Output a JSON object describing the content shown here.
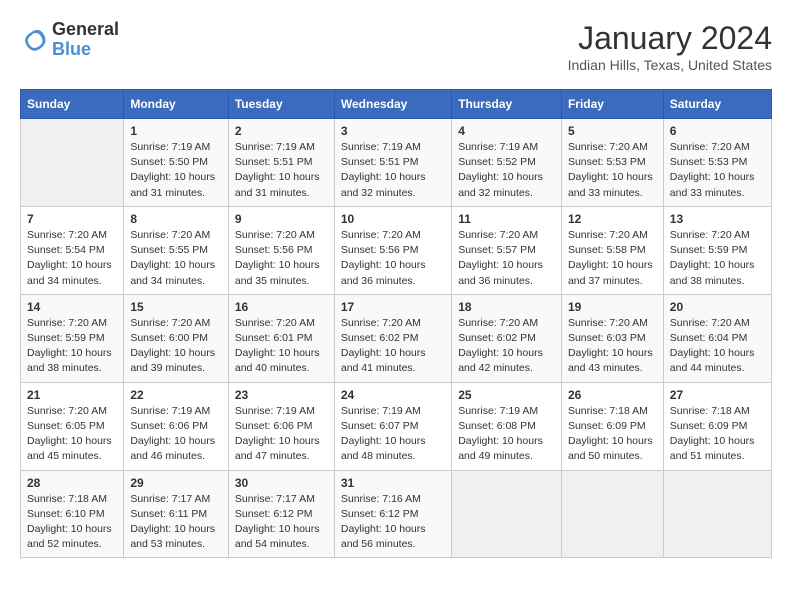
{
  "header": {
    "logo_line1": "General",
    "logo_line2": "Blue",
    "title": "January 2024",
    "subtitle": "Indian Hills, Texas, United States"
  },
  "days_of_week": [
    "Sunday",
    "Monday",
    "Tuesday",
    "Wednesday",
    "Thursday",
    "Friday",
    "Saturday"
  ],
  "weeks": [
    [
      {
        "num": "",
        "empty": true
      },
      {
        "num": "1",
        "sunrise": "7:19 AM",
        "sunset": "5:50 PM",
        "daylight": "10 hours and 31 minutes."
      },
      {
        "num": "2",
        "sunrise": "7:19 AM",
        "sunset": "5:51 PM",
        "daylight": "10 hours and 31 minutes."
      },
      {
        "num": "3",
        "sunrise": "7:19 AM",
        "sunset": "5:51 PM",
        "daylight": "10 hours and 32 minutes."
      },
      {
        "num": "4",
        "sunrise": "7:19 AM",
        "sunset": "5:52 PM",
        "daylight": "10 hours and 32 minutes."
      },
      {
        "num": "5",
        "sunrise": "7:20 AM",
        "sunset": "5:53 PM",
        "daylight": "10 hours and 33 minutes."
      },
      {
        "num": "6",
        "sunrise": "7:20 AM",
        "sunset": "5:53 PM",
        "daylight": "10 hours and 33 minutes."
      }
    ],
    [
      {
        "num": "7",
        "sunrise": "7:20 AM",
        "sunset": "5:54 PM",
        "daylight": "10 hours and 34 minutes."
      },
      {
        "num": "8",
        "sunrise": "7:20 AM",
        "sunset": "5:55 PM",
        "daylight": "10 hours and 34 minutes."
      },
      {
        "num": "9",
        "sunrise": "7:20 AM",
        "sunset": "5:56 PM",
        "daylight": "10 hours and 35 minutes."
      },
      {
        "num": "10",
        "sunrise": "7:20 AM",
        "sunset": "5:56 PM",
        "daylight": "10 hours and 36 minutes."
      },
      {
        "num": "11",
        "sunrise": "7:20 AM",
        "sunset": "5:57 PM",
        "daylight": "10 hours and 36 minutes."
      },
      {
        "num": "12",
        "sunrise": "7:20 AM",
        "sunset": "5:58 PM",
        "daylight": "10 hours and 37 minutes."
      },
      {
        "num": "13",
        "sunrise": "7:20 AM",
        "sunset": "5:59 PM",
        "daylight": "10 hours and 38 minutes."
      }
    ],
    [
      {
        "num": "14",
        "sunrise": "7:20 AM",
        "sunset": "5:59 PM",
        "daylight": "10 hours and 38 minutes."
      },
      {
        "num": "15",
        "sunrise": "7:20 AM",
        "sunset": "6:00 PM",
        "daylight": "10 hours and 39 minutes."
      },
      {
        "num": "16",
        "sunrise": "7:20 AM",
        "sunset": "6:01 PM",
        "daylight": "10 hours and 40 minutes."
      },
      {
        "num": "17",
        "sunrise": "7:20 AM",
        "sunset": "6:02 PM",
        "daylight": "10 hours and 41 minutes."
      },
      {
        "num": "18",
        "sunrise": "7:20 AM",
        "sunset": "6:02 PM",
        "daylight": "10 hours and 42 minutes."
      },
      {
        "num": "19",
        "sunrise": "7:20 AM",
        "sunset": "6:03 PM",
        "daylight": "10 hours and 43 minutes."
      },
      {
        "num": "20",
        "sunrise": "7:20 AM",
        "sunset": "6:04 PM",
        "daylight": "10 hours and 44 minutes."
      }
    ],
    [
      {
        "num": "21",
        "sunrise": "7:20 AM",
        "sunset": "6:05 PM",
        "daylight": "10 hours and 45 minutes."
      },
      {
        "num": "22",
        "sunrise": "7:19 AM",
        "sunset": "6:06 PM",
        "daylight": "10 hours and 46 minutes."
      },
      {
        "num": "23",
        "sunrise": "7:19 AM",
        "sunset": "6:06 PM",
        "daylight": "10 hours and 47 minutes."
      },
      {
        "num": "24",
        "sunrise": "7:19 AM",
        "sunset": "6:07 PM",
        "daylight": "10 hours and 48 minutes."
      },
      {
        "num": "25",
        "sunrise": "7:19 AM",
        "sunset": "6:08 PM",
        "daylight": "10 hours and 49 minutes."
      },
      {
        "num": "26",
        "sunrise": "7:18 AM",
        "sunset": "6:09 PM",
        "daylight": "10 hours and 50 minutes."
      },
      {
        "num": "27",
        "sunrise": "7:18 AM",
        "sunset": "6:09 PM",
        "daylight": "10 hours and 51 minutes."
      }
    ],
    [
      {
        "num": "28",
        "sunrise": "7:18 AM",
        "sunset": "6:10 PM",
        "daylight": "10 hours and 52 minutes."
      },
      {
        "num": "29",
        "sunrise": "7:17 AM",
        "sunset": "6:11 PM",
        "daylight": "10 hours and 53 minutes."
      },
      {
        "num": "30",
        "sunrise": "7:17 AM",
        "sunset": "6:12 PM",
        "daylight": "10 hours and 54 minutes."
      },
      {
        "num": "31",
        "sunrise": "7:16 AM",
        "sunset": "6:12 PM",
        "daylight": "10 hours and 56 minutes."
      },
      {
        "num": "",
        "empty": true
      },
      {
        "num": "",
        "empty": true
      },
      {
        "num": "",
        "empty": true
      }
    ]
  ]
}
